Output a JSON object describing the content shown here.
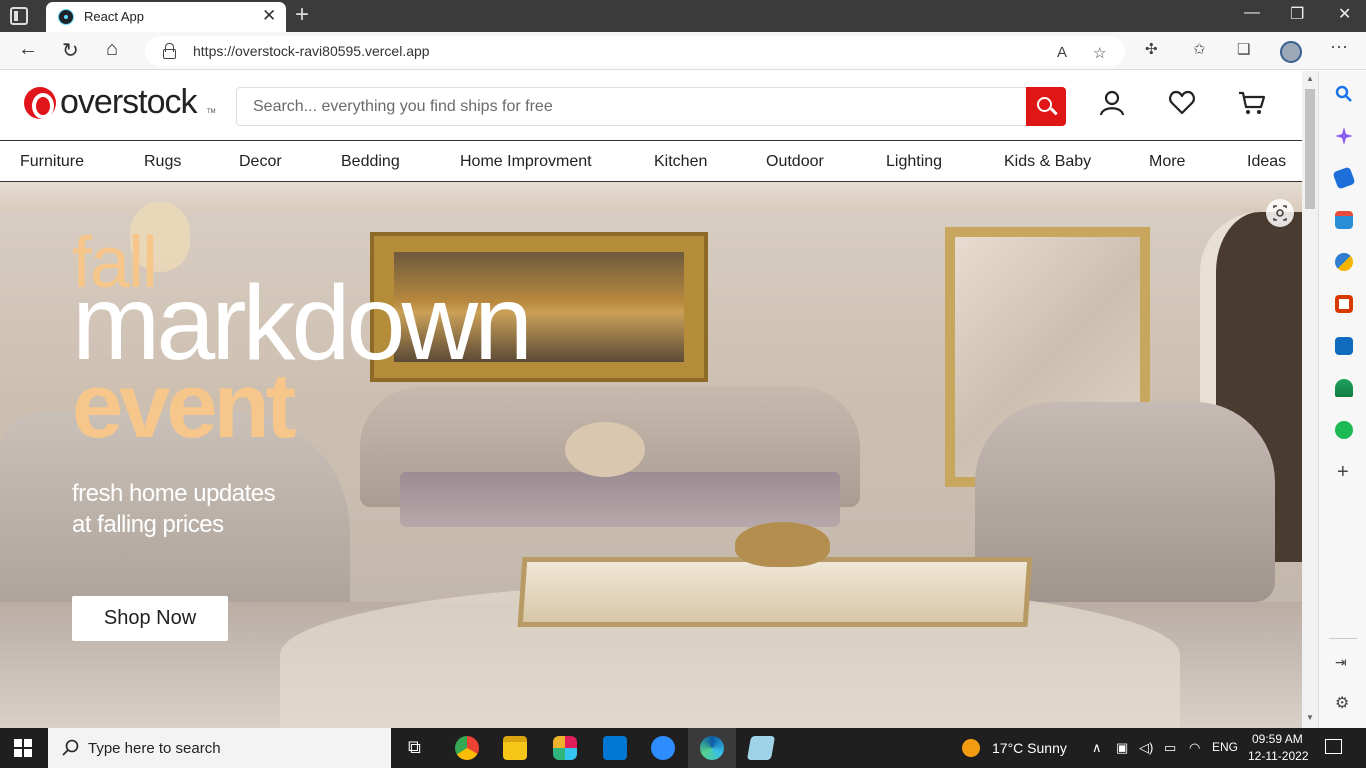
{
  "browser": {
    "tab_title": "React App",
    "url": "https://overstock-ravi80595.vercel.app"
  },
  "site": {
    "logo_text": "overstock",
    "logo_tm": "TM",
    "search_placeholder": "Search... everything you find ships for free",
    "brand_color": "#e01515"
  },
  "nav": {
    "items": [
      "Furniture",
      "Rugs",
      "Decor",
      "Bedding",
      "Home Improvment",
      "Kitchen",
      "Outdoor",
      "Lighting",
      "Kids & Baby",
      "More",
      "Ideas"
    ]
  },
  "hero": {
    "headline_1": "fall",
    "headline_2": "markdown",
    "headline_3": "event",
    "subtitle_1": "fresh home updates",
    "subtitle_2": "at falling prices",
    "cta_label": "Shop Now",
    "accent_color": "#f6c68a"
  },
  "taskbar": {
    "search_text": "Type here to search",
    "weather": "17°C  Sunny",
    "language": "ENG",
    "time": "09:59 AM",
    "date": "12-11-2022"
  }
}
